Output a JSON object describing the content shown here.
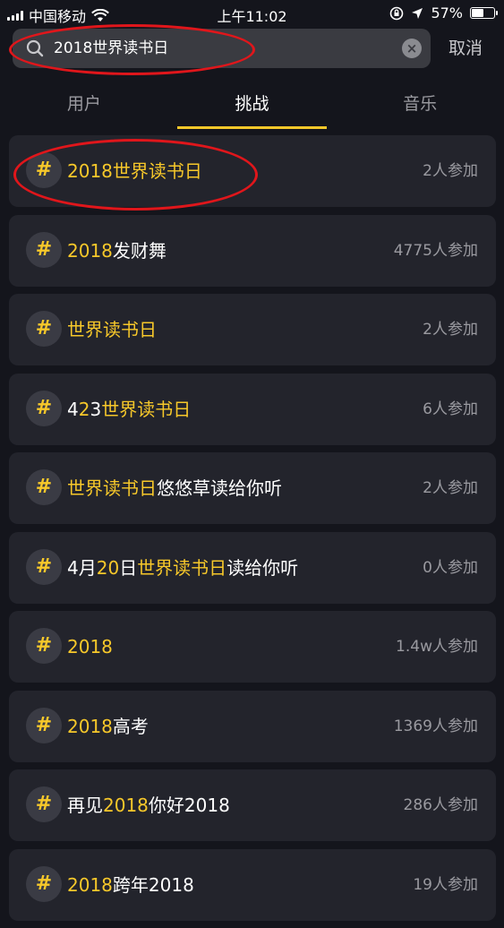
{
  "status_bar": {
    "carrier": "中国移动",
    "time": "上午11:02",
    "battery_percent": "57%",
    "battery_level": 0.57,
    "icons": [
      "signal-icon",
      "wifi-icon",
      "rotation-lock-icon",
      "location-icon",
      "battery-icon"
    ]
  },
  "search": {
    "query": "2018世界读书日",
    "cancel_label": "取消"
  },
  "tabs": [
    {
      "label": "用户",
      "active": false
    },
    {
      "label": "挑战",
      "active": true
    },
    {
      "label": "音乐",
      "active": false
    }
  ],
  "results": [
    {
      "segments": [
        {
          "text": "2018世界读书日",
          "hl": true
        }
      ],
      "count": "2人参加"
    },
    {
      "segments": [
        {
          "text": "2018",
          "hl": true
        },
        {
          "text": "发财舞",
          "hl": false
        }
      ],
      "count": "4775人参加"
    },
    {
      "segments": [
        {
          "text": "世界读书日",
          "hl": true
        }
      ],
      "count": "2人参加"
    },
    {
      "segments": [
        {
          "text": "4",
          "hl": false
        },
        {
          "text": "2",
          "hl": true
        },
        {
          "text": "3",
          "hl": false
        },
        {
          "text": "世界读书日",
          "hl": true
        }
      ],
      "count": "6人参加"
    },
    {
      "segments": [
        {
          "text": "世界读书日",
          "hl": true
        },
        {
          "text": "悠悠草读给你听",
          "hl": false
        }
      ],
      "count": "2人参加"
    },
    {
      "segments": [
        {
          "text": "4月",
          "hl": false
        },
        {
          "text": "20",
          "hl": true
        },
        {
          "text": "日",
          "hl": false
        },
        {
          "text": "世界读书日",
          "hl": true
        },
        {
          "text": "读给你听",
          "hl": false
        }
      ],
      "count": "0人参加"
    },
    {
      "segments": [
        {
          "text": "2018",
          "hl": true
        }
      ],
      "count": "1.4w人参加"
    },
    {
      "segments": [
        {
          "text": "2018",
          "hl": true
        },
        {
          "text": "高考",
          "hl": false
        }
      ],
      "count": "1369人参加"
    },
    {
      "segments": [
        {
          "text": "再见",
          "hl": false
        },
        {
          "text": "2018",
          "hl": true
        },
        {
          "text": "你好2018",
          "hl": false
        }
      ],
      "count": "286人参加"
    },
    {
      "segments": [
        {
          "text": "2018",
          "hl": true
        },
        {
          "text": "跨年2018",
          "hl": false
        }
      ],
      "count": "19人参加"
    }
  ],
  "hash_symbol": "#",
  "colors": {
    "accent": "#f7c82a",
    "background": "#14151c",
    "card": "#23242c",
    "annotation_ring": "#e0161b"
  }
}
